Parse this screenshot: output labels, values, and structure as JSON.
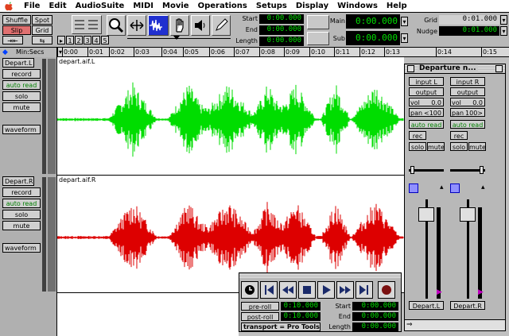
{
  "menubar": {
    "items": [
      "File",
      "Edit",
      "AudioSuite",
      "MIDI",
      "Movie",
      "Operations",
      "Setups",
      "Display",
      "Windows",
      "Help"
    ]
  },
  "toolbar": {
    "modes": {
      "shuffle": "Shuffle",
      "spot": "Spot",
      "slip": "Slip",
      "grid": "Grid"
    },
    "zoom_presets": [
      "1",
      "2",
      "3",
      "4",
      "5"
    ],
    "counters": {
      "start_label": "Start",
      "start": "0:00.000",
      "end_label": "End",
      "end": "0:00.000",
      "length_label": "Length",
      "length": "0:00.000"
    },
    "main": {
      "main_label": "Main",
      "main_value": "0:00.000",
      "sub_label": "Sub",
      "sub_value": "0:00.000"
    },
    "grid": {
      "grid_label": "Grid",
      "grid_value": "0:01.000",
      "nudge_label": "Nudge",
      "nudge_value": "0:01.000"
    }
  },
  "ruler": {
    "label": "Min:Secs",
    "ticks": [
      "0:00",
      "0:01",
      "0:02",
      "0:03",
      "0:04",
      "0:05",
      "0:06",
      "0:07",
      "0:08",
      "0:09",
      "0:10",
      "0:11",
      "0:12",
      "0:13",
      "0:14",
      "0:15"
    ]
  },
  "tracks": [
    {
      "name": "Depart.L",
      "record": "record",
      "auto": "auto read",
      "solo": "solo",
      "mute": "mute",
      "view": "waveform",
      "region": "depart.aif.L",
      "color": "#00dd00"
    },
    {
      "name": "Depart.R",
      "record": "record",
      "auto": "auto read",
      "solo": "solo",
      "mute": "mute",
      "view": "waveform",
      "region": "depart.aif.R",
      "color": "#dd0000"
    }
  ],
  "mixer": {
    "title": "Departure n...",
    "channels": [
      {
        "input": "input L",
        "output": "output",
        "vol": "vol",
        "vol_value": "0.0",
        "pan": "pan",
        "pan_value": "<100",
        "auto": "auto read",
        "rec": "rec",
        "solo": "solo",
        "mute": "mute",
        "name": "Depart.L"
      },
      {
        "input": "input R",
        "output": "output",
        "vol": "vol",
        "vol_value": "0.0",
        "pan": "pan",
        "pan_value": "100>",
        "auto": "auto read",
        "rec": "rec",
        "solo": "solo",
        "mute": "mute",
        "name": "Depart.R"
      }
    ]
  },
  "transport": {
    "preroll": "pre-roll",
    "preroll_value": "0:10.000",
    "postroll": "post-roll",
    "postroll_value": "0:10.000",
    "start_label": "Start",
    "start": "0:00.000",
    "end_label": "End",
    "end": "0:00.000",
    "length_label": "Length",
    "length": "0:00.000",
    "transport_label": "transport = Pro Tools"
  }
}
